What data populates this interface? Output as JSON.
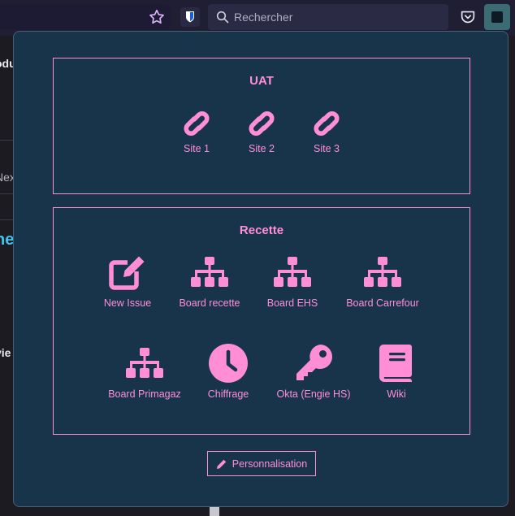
{
  "toolbar": {
    "search_placeholder": "Rechercher"
  },
  "background_page": {
    "fragments": [
      "odu",
      "Nex",
      "ne",
      "vie"
    ]
  },
  "popup": {
    "sections": [
      {
        "title": "UAT",
        "items": [
          {
            "label": "Site 1",
            "icon": "link-icon"
          },
          {
            "label": "Site 2",
            "icon": "link-icon"
          },
          {
            "label": "Site 3",
            "icon": "link-icon"
          }
        ]
      },
      {
        "title": "Recette",
        "items": [
          {
            "label": "New Issue",
            "icon": "edit-icon"
          },
          {
            "label": "Board recette",
            "icon": "sitemap-icon"
          },
          {
            "label": "Board EHS",
            "icon": "sitemap-icon"
          },
          {
            "label": "Board Carrefour",
            "icon": "sitemap-icon"
          },
          {
            "label": "Board Primagaz",
            "icon": "sitemap-icon"
          },
          {
            "label": "Chiffrage",
            "icon": "clock-icon"
          },
          {
            "label": "Okta (Engie HS)",
            "icon": "key-icon"
          },
          {
            "label": "Wiki",
            "icon": "book-icon"
          }
        ]
      }
    ],
    "customize_label": "Personnalisation"
  },
  "colors": {
    "accent": "#ff8ed6",
    "popup_bg": "#17344b"
  }
}
